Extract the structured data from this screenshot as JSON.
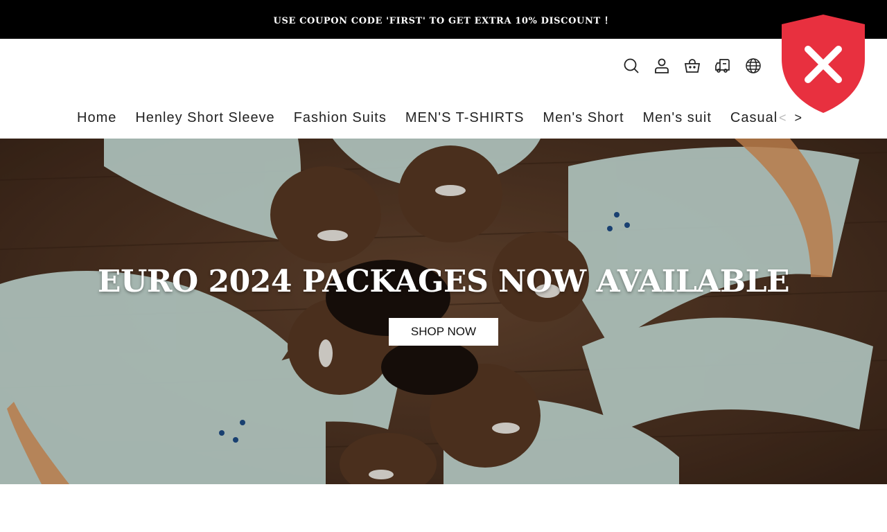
{
  "announcement": {
    "text": "USE COUPON CODE 'FIRST' TO GET EXTRA 10% DISCOUNT ！"
  },
  "header": {
    "icons": [
      "search-icon",
      "account-icon",
      "cart-icon",
      "shipping-truck-icon",
      "globe-icon"
    ]
  },
  "nav": {
    "items": [
      {
        "label": "Home"
      },
      {
        "label": "Henley Short Sleeve"
      },
      {
        "label": "Fashion Suits"
      },
      {
        "label": "MEN'S T-SHIRTS"
      },
      {
        "label": "Men's Short"
      },
      {
        "label": "Men's suit"
      },
      {
        "label": "Casual"
      }
    ],
    "prev_arrow": "<",
    "next_arrow": ">"
  },
  "hero": {
    "title": "EURO 2024 PACKAGES NOW AVAILABLE",
    "button_label": "SHOP NOW"
  },
  "security_badge": {
    "icon": "shield-close-icon",
    "color": "#e8303f"
  },
  "colors": {
    "announce_bg": "#000000",
    "accent": "#e8303f",
    "hero_button_bg": "#ffffff"
  }
}
